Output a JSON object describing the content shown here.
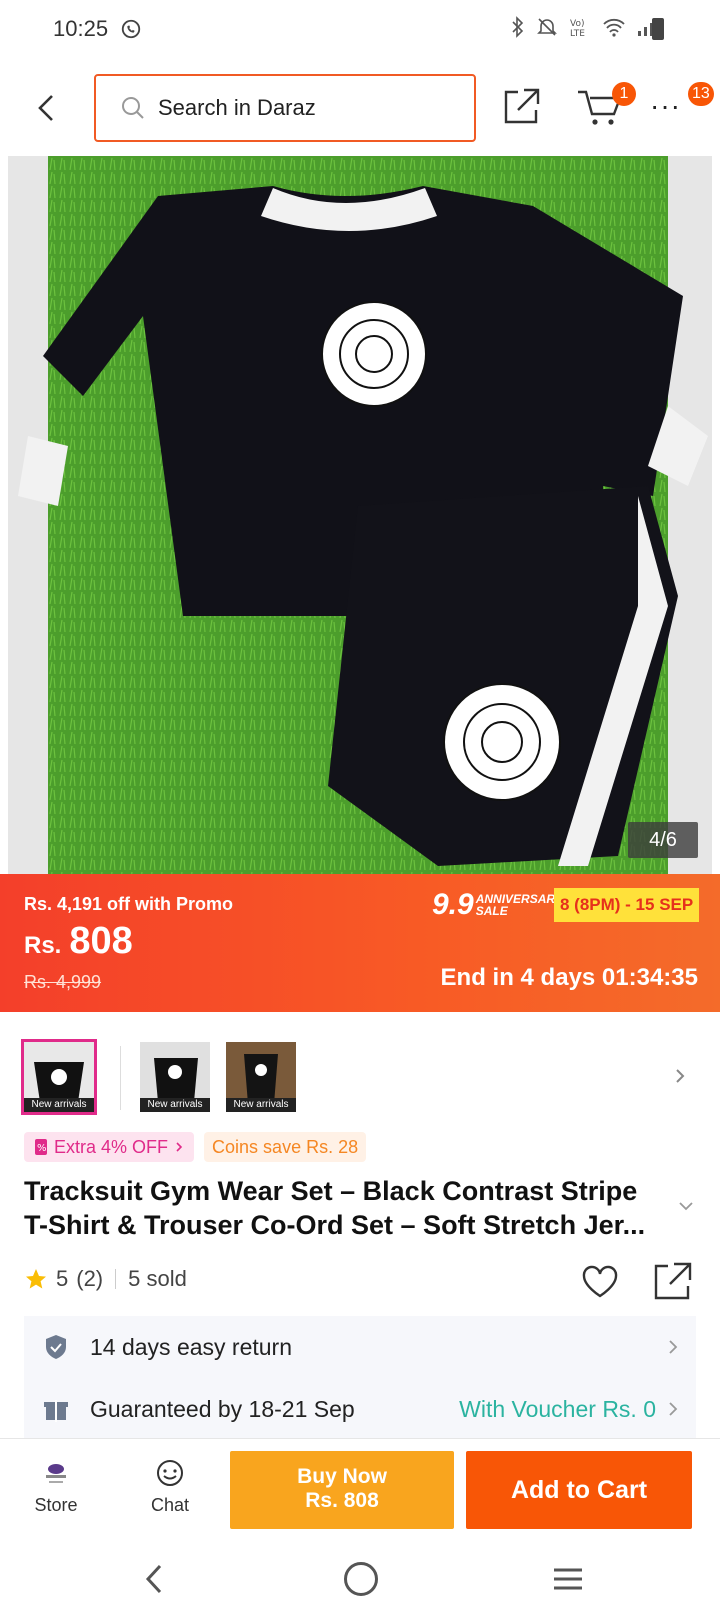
{
  "status_bar": {
    "time": "10:25",
    "icons": [
      "whatsapp-icon",
      "bluetooth-icon",
      "mute-icon",
      "volte-icon",
      "wifi-icon",
      "signal-icon",
      "battery-icon"
    ]
  },
  "header": {
    "search_placeholder": "Search in Daraz",
    "cart_count": "1",
    "more_count": "13"
  },
  "gallery": {
    "counter": "4/6"
  },
  "promo": {
    "off_text": "Rs. 4,191 off with Promo",
    "currency": "Rs.",
    "price": "808",
    "original_price": "Rs. 4,999",
    "sale_number": "9.9",
    "sale_word": "ANNIVERSARY SALE",
    "sale_dates": "8 (8PM) - 15 SEP",
    "ends_in": "End in 4 days 01:34:35",
    "colors": {
      "start": "#f43f2a",
      "end": "#f46b2a",
      "date_bg": "#ffe13a"
    }
  },
  "thumbnails": [
    {
      "label": "New arrivals"
    },
    {
      "label": "New arrivals"
    },
    {
      "label": "New arrivals"
    }
  ],
  "tags": {
    "voucher": "Extra 4% OFF",
    "coins": "Coins save Rs. 28"
  },
  "product": {
    "title_line1": "Tracksuit Gym Wear Set – Black Contrast Stripe",
    "title_line2": "T-Shirt & Trouser Co-Ord Set – Soft Stretch Jer...",
    "rating": "5",
    "reviews": "(2)",
    "sold": "5 sold"
  },
  "service": {
    "return": "14 days easy return",
    "delivery": "Guaranteed by 18-21 Sep",
    "voucher": "With Voucher Rs. 0"
  },
  "actions": {
    "store": "Store",
    "chat": "Chat",
    "buy_now_line1": "Buy Now",
    "buy_now_line2": "Rs. 808",
    "add_to_cart": "Add to Cart",
    "colors": {
      "buy": "#f9a51e",
      "cart": "#f85606"
    }
  }
}
